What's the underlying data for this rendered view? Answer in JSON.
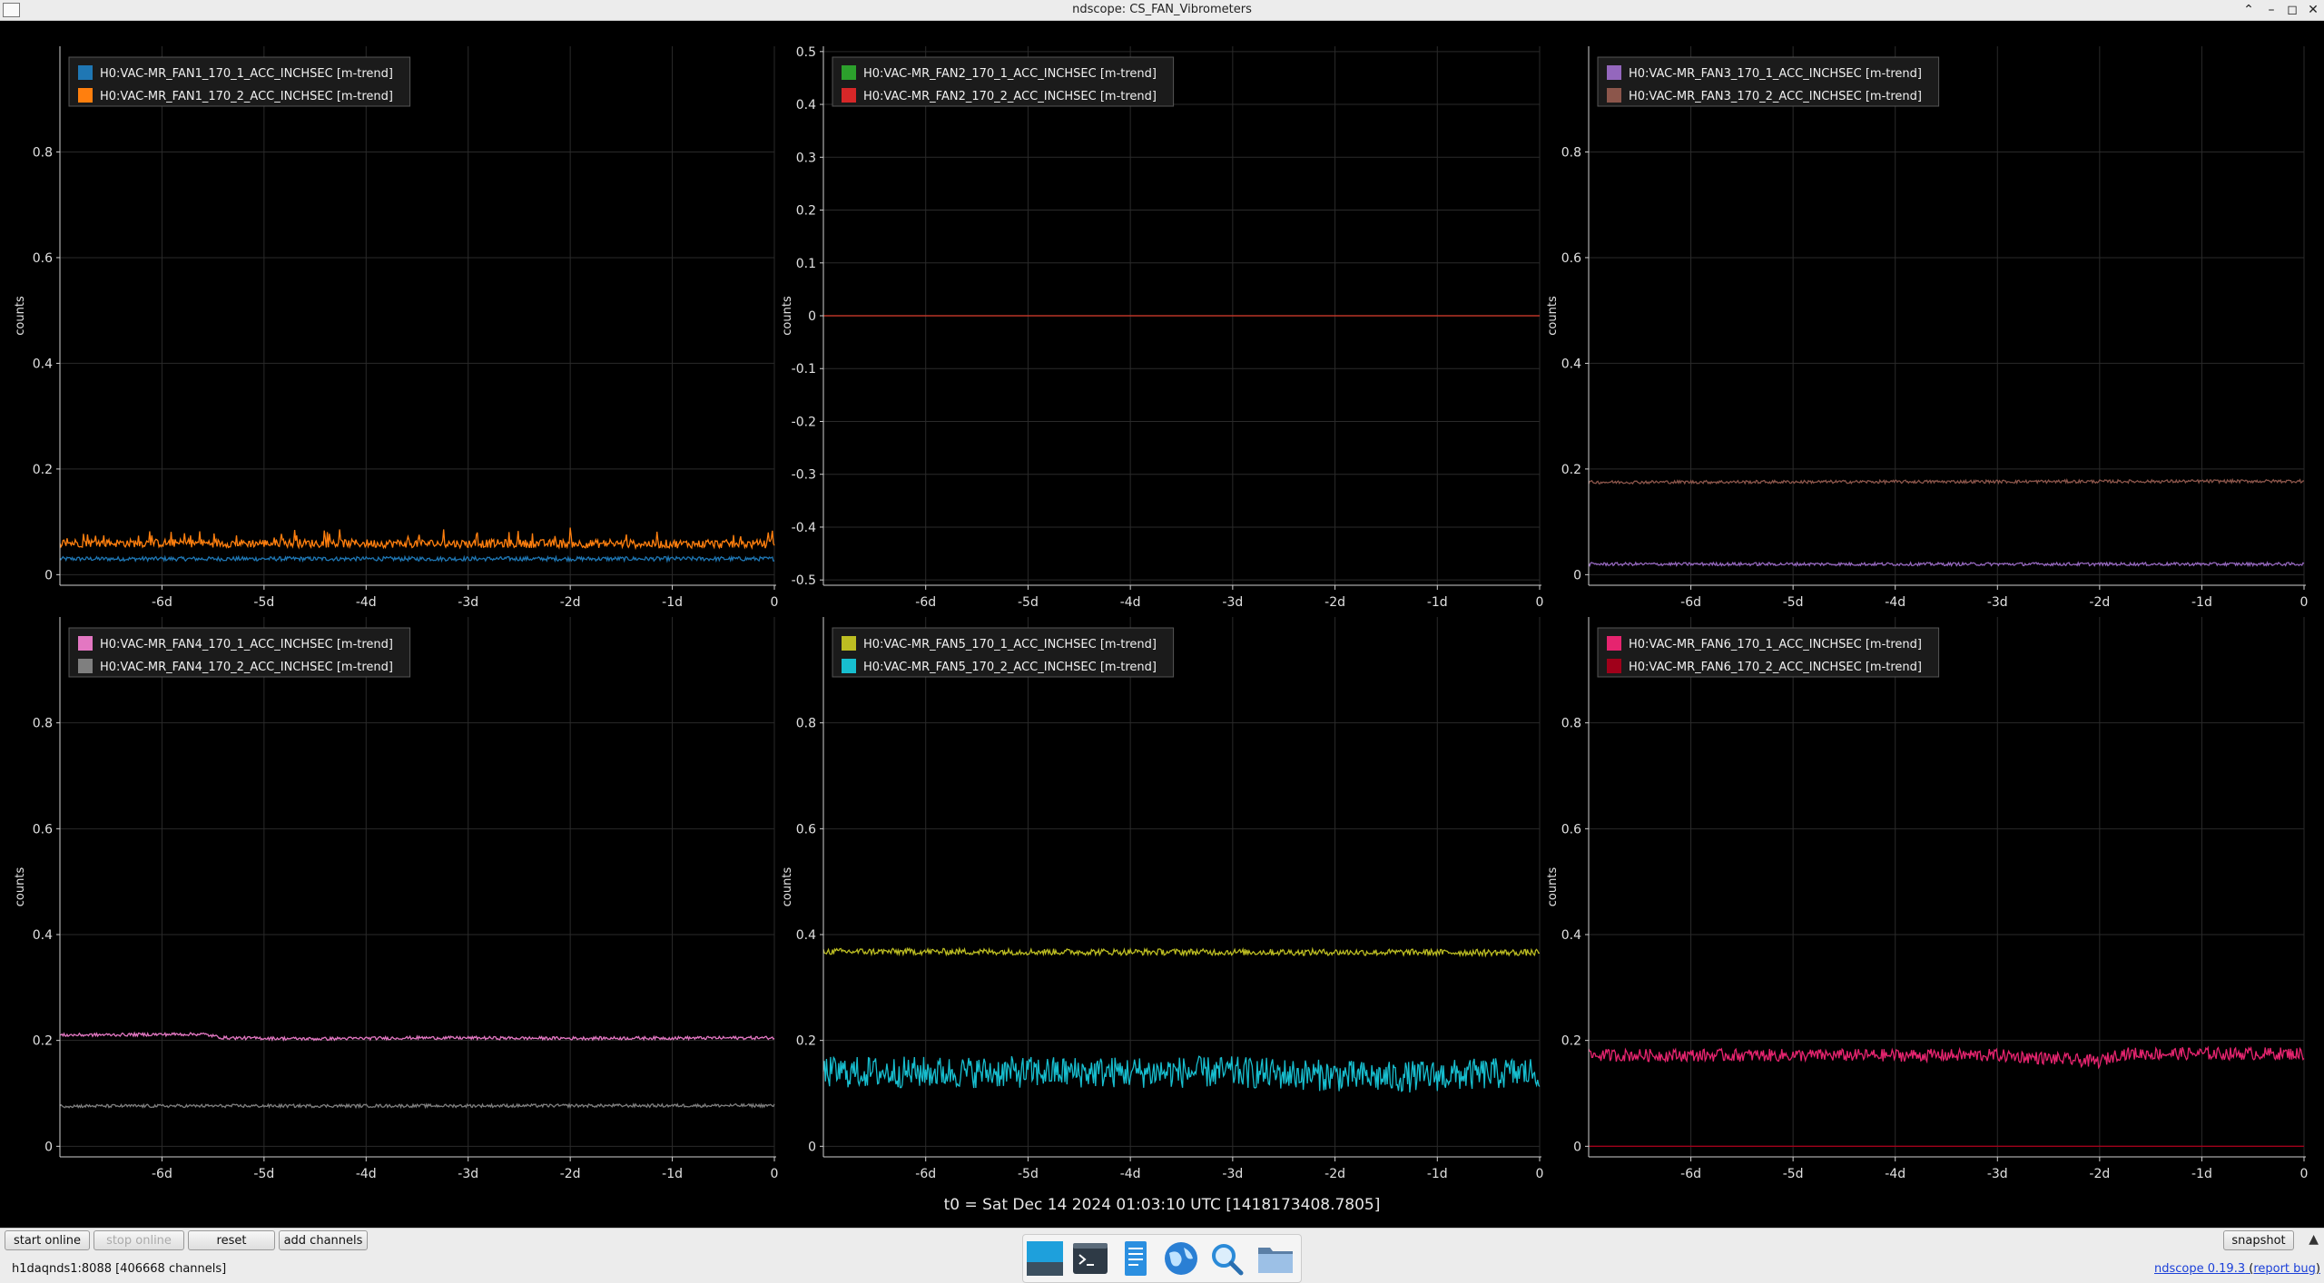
{
  "window": {
    "title": "ndscope: CS_FAN_Vibrometers"
  },
  "colors": {
    "background": "#000000",
    "axis": "#d0d0d0",
    "grid": "#2a2a2a",
    "legend_bg": "#1b1b1b",
    "legend_border": "#555555"
  },
  "chart_data": [
    {
      "type": "line",
      "ylabel": "counts",
      "xticks": [
        "-6d",
        "-5d",
        "-4d",
        "-3d",
        "-2d",
        "-1d",
        "0"
      ],
      "xlim": [
        -7,
        0
      ],
      "ylim": [
        -0.02,
        1.0
      ],
      "yticks": [
        0,
        0.2,
        0.4,
        0.6,
        0.8
      ],
      "series": [
        {
          "name": "H0:VAC-MR_FAN1_170_1_ACC_INCHSEC [m-trend]",
          "color": "#1f77b4",
          "x": [
            -7,
            0
          ],
          "y": [
            0.03,
            0.03
          ],
          "noise": 0.004
        },
        {
          "name": "H0:VAC-MR_FAN1_170_2_ACC_INCHSEC [m-trend]",
          "color": "#ff7f0e",
          "x": [
            -7,
            0
          ],
          "y": [
            0.06,
            0.058
          ],
          "noise": 0.008,
          "spikes": 0.025
        }
      ]
    },
    {
      "type": "line",
      "ylabel": "counts",
      "xticks": [
        "-6d",
        "-5d",
        "-4d",
        "-3d",
        "-2d",
        "-1d",
        "0"
      ],
      "xlim": [
        -7,
        0
      ],
      "ylim": [
        -0.51,
        0.51
      ],
      "yticks": [
        0.5,
        0.4,
        0.3,
        0.2,
        0.1,
        0,
        -0.1,
        -0.2,
        -0.3,
        -0.4,
        -0.5
      ],
      "series": [
        {
          "name": "H0:VAC-MR_FAN2_170_1_ACC_INCHSEC [m-trend]",
          "color": "#2ca02c",
          "x": [
            -7,
            0
          ],
          "y": [
            0,
            0
          ],
          "noise": 0
        },
        {
          "name": "H0:VAC-MR_FAN2_170_2_ACC_INCHSEC [m-trend]",
          "color": "#d62728",
          "x": [
            -7,
            0
          ],
          "y": [
            0,
            0
          ],
          "noise": 0
        }
      ]
    },
    {
      "type": "line",
      "ylabel": "counts",
      "xticks": [
        "-6d",
        "-5d",
        "-4d",
        "-3d",
        "-2d",
        "-1d",
        "0"
      ],
      "xlim": [
        -7,
        0
      ],
      "ylim": [
        -0.02,
        1.0
      ],
      "yticks": [
        0,
        0.2,
        0.4,
        0.6,
        0.8
      ],
      "series": [
        {
          "name": "H0:VAC-MR_FAN3_170_1_ACC_INCHSEC [m-trend]",
          "color": "#9467bd",
          "x": [
            -7,
            0
          ],
          "y": [
            0.02,
            0.02
          ],
          "noise": 0.003
        },
        {
          "name": "H0:VAC-MR_FAN3_170_2_ACC_INCHSEC [m-trend]",
          "color": "#8c564b",
          "x": [
            -7,
            0
          ],
          "y": [
            0.175,
            0.177
          ],
          "noise": 0.003
        }
      ]
    },
    {
      "type": "line",
      "ylabel": "counts",
      "xticks": [
        "-6d",
        "-5d",
        "-4d",
        "-3d",
        "-2d",
        "-1d",
        "0"
      ],
      "xlim": [
        -7,
        0
      ],
      "ylim": [
        -0.02,
        1.0
      ],
      "yticks": [
        0,
        0.2,
        0.4,
        0.6,
        0.8
      ],
      "series": [
        {
          "name": "H0:VAC-MR_FAN4_170_1_ACC_INCHSEC [m-trend]",
          "color": "#e377c2",
          "x": [
            -7,
            -5.6,
            -5.4,
            -4.5,
            -3.5,
            -2,
            0
          ],
          "y": [
            0.21,
            0.212,
            0.205,
            0.203,
            0.205,
            0.204,
            0.205
          ],
          "noise": 0.003
        },
        {
          "name": "H0:VAC-MR_FAN4_170_2_ACC_INCHSEC [m-trend]",
          "color": "#7f7f7f",
          "x": [
            -7,
            0
          ],
          "y": [
            0.076,
            0.077
          ],
          "noise": 0.003
        }
      ]
    },
    {
      "type": "line",
      "ylabel": "counts",
      "xticks": [
        "-6d",
        "-5d",
        "-4d",
        "-3d",
        "-2d",
        "-1d",
        "0"
      ],
      "xlim": [
        -7,
        0
      ],
      "ylim": [
        -0.02,
        1.0
      ],
      "yticks": [
        0,
        0.2,
        0.4,
        0.6,
        0.8
      ],
      "series": [
        {
          "name": "H0:VAC-MR_FAN5_170_1_ACC_INCHSEC [m-trend]",
          "color": "#bcbd22",
          "x": [
            -7,
            0
          ],
          "y": [
            0.368,
            0.366
          ],
          "noise": 0.006
        },
        {
          "name": "H0:VAC-MR_FAN5_170_2_ACC_INCHSEC [m-trend]",
          "color": "#17becf",
          "x": [
            -7,
            -5,
            -3,
            -1.5,
            0
          ],
          "y": [
            0.14,
            0.14,
            0.14,
            0.13,
            0.14
          ],
          "noise": 0.03
        }
      ]
    },
    {
      "type": "line",
      "ylabel": "counts",
      "xticks": [
        "-6d",
        "-5d",
        "-4d",
        "-3d",
        "-2d",
        "-1d",
        "0"
      ],
      "xlim": [
        -7,
        0
      ],
      "ylim": [
        -0.02,
        1.0
      ],
      "yticks": [
        0,
        0.2,
        0.4,
        0.6,
        0.8
      ],
      "series": [
        {
          "name": "H0:VAC-MR_FAN6_170_1_ACC_INCHSEC [m-trend]",
          "color": "#e6246f",
          "x": [
            -7,
            -3,
            -2,
            -1.8,
            0
          ],
          "y": [
            0.172,
            0.172,
            0.16,
            0.175,
            0.175
          ],
          "noise": 0.012
        },
        {
          "name": "H0:VAC-MR_FAN6_170_2_ACC_INCHSEC [m-trend]",
          "color": "#a0001a",
          "x": [
            -7,
            0
          ],
          "y": [
            0,
            0
          ],
          "noise": 0
        }
      ]
    }
  ],
  "t0_label": "t0 = Sat Dec 14 2024 01:03:10 UTC [1418173408.7805]",
  "toolbar": {
    "start_online": "start online",
    "stop_online": "stop online",
    "reset": "reset",
    "add_channels": "add channels",
    "snapshot": "snapshot"
  },
  "status": {
    "server": "h1daqnds1:8088  [406668 channels]",
    "version_link": "ndscope 0.19.3",
    "report_bug": "report bug"
  },
  "dock": {
    "items": [
      "workspace-icon",
      "terminal-icon",
      "text-editor-icon",
      "web-browser-icon",
      "search-icon",
      "file-manager-icon"
    ]
  }
}
